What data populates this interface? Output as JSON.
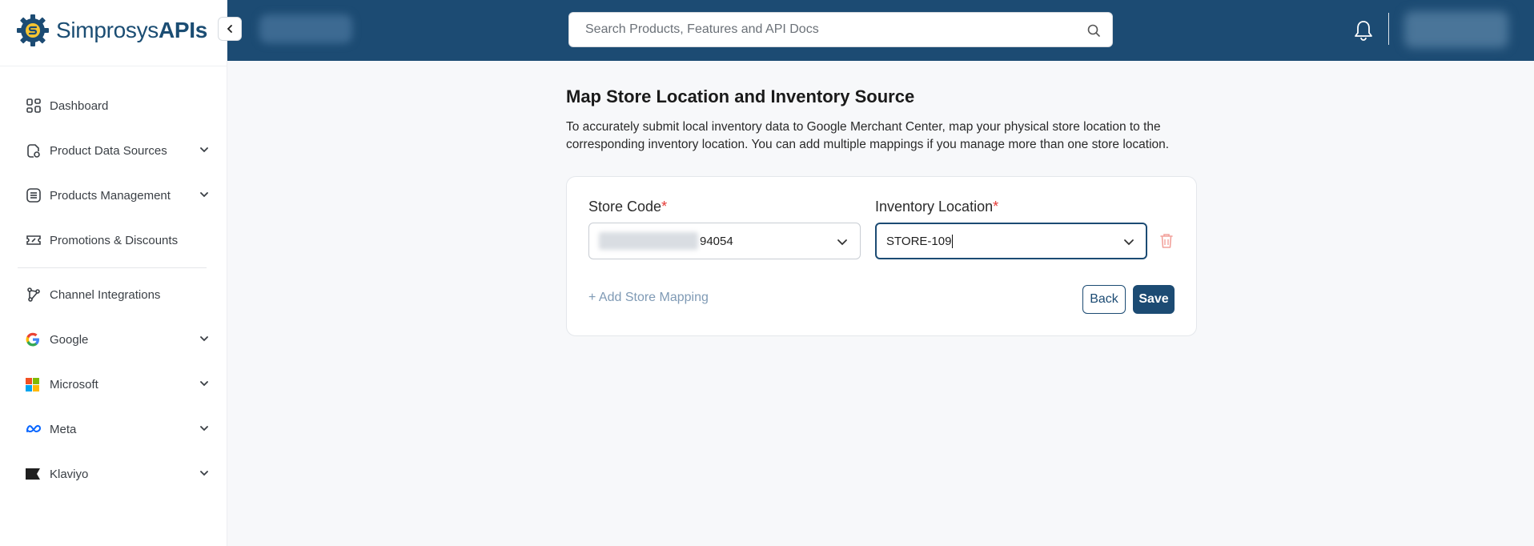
{
  "app": {
    "name_plain": "Simprosys",
    "name_bold": "APIs"
  },
  "sidebar": {
    "items": [
      {
        "label": "Dashboard",
        "icon": "dashboard-grid-icon",
        "has_chevron": false
      },
      {
        "label": "Product Data Sources",
        "icon": "product-data-sources-icon",
        "has_chevron": true
      },
      {
        "label": "Products Management",
        "icon": "list-icon",
        "has_chevron": true
      },
      {
        "label": "Promotions & Discounts",
        "icon": "discount-ticket-icon",
        "has_chevron": false
      },
      {
        "label": "Channel Integrations",
        "icon": "integration-nodes-icon",
        "has_chevron": false
      },
      {
        "label": "Google",
        "icon": "google-logo-icon",
        "has_chevron": true
      },
      {
        "label": "Microsoft",
        "icon": "microsoft-logo-icon",
        "has_chevron": true
      },
      {
        "label": "Meta",
        "icon": "meta-logo-icon",
        "has_chevron": true
      },
      {
        "label": "Klaviyo",
        "icon": "klaviyo-flag-icon",
        "has_chevron": true
      }
    ]
  },
  "header": {
    "search_placeholder": "Search Products, Features and API Docs",
    "search_value": ""
  },
  "main": {
    "title": "Map Store Location and Inventory Source",
    "description": "To accurately submit local inventory data to Google Merchant Center, map your physical store location to the corresponding inventory location. You can add multiple mappings if you manage more than one store location.",
    "store_code": {
      "label": "Store Code",
      "required_mark": "*",
      "value_visible_suffix": "94054"
    },
    "inventory_location": {
      "label": "Inventory Location",
      "required_mark": "*",
      "value": "STORE-109"
    },
    "add_mapping_label": "+ Add Store Mapping",
    "back_label": "Back",
    "save_label": "Save"
  },
  "colors": {
    "brand_navy": "#1c4b73",
    "required_red": "#e53935",
    "trash_red": "#f2a19b",
    "link_muted": "#7f9ab5"
  }
}
